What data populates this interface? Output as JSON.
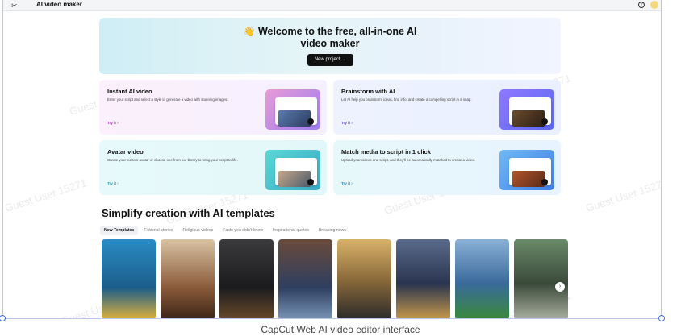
{
  "app": {
    "logo_glyph": "✂",
    "title": "AI video maker",
    "help_glyph": "?"
  },
  "hero": {
    "emoji": "👋",
    "title_line1": "Welcome to the free, all-in-one AI",
    "title_line2": "video maker",
    "button_label": "New project →"
  },
  "cards": [
    {
      "title": "Instant AI video",
      "desc": "Enter your script and select a style to generate a video with stunning images.",
      "try": "Try it ›",
      "color": "#b13abf"
    },
    {
      "title": "Brainstorm with AI",
      "desc": "Let AI help you brainstorm ideas, find info, and create a compelling script in a snap.",
      "try": "Try it ›",
      "color": "#6a4cd6"
    },
    {
      "title": "Avatar video",
      "desc": "Create your custom avatar or choose one from our library to bring your script to life.",
      "try": "Try it ›",
      "color": "#2d9da8"
    },
    {
      "title": "Match media to script in 1 click",
      "desc": "Upload your videos and script, and they'll be automatically matched to create a video.",
      "try": "Try it ›",
      "color": "#2d88b8"
    }
  ],
  "templates": {
    "section_title": "Simplify creation with AI templates",
    "tabs": [
      "New Templates",
      "Fictional stories",
      "Religious videos",
      "Facts you didn't know",
      "Inspirational quotes",
      "Breaking news"
    ],
    "active_tab": 0,
    "next_glyph": "›"
  },
  "watermark": "Guest User 15271",
  "caption": "CapCut Web AI video editor interface"
}
